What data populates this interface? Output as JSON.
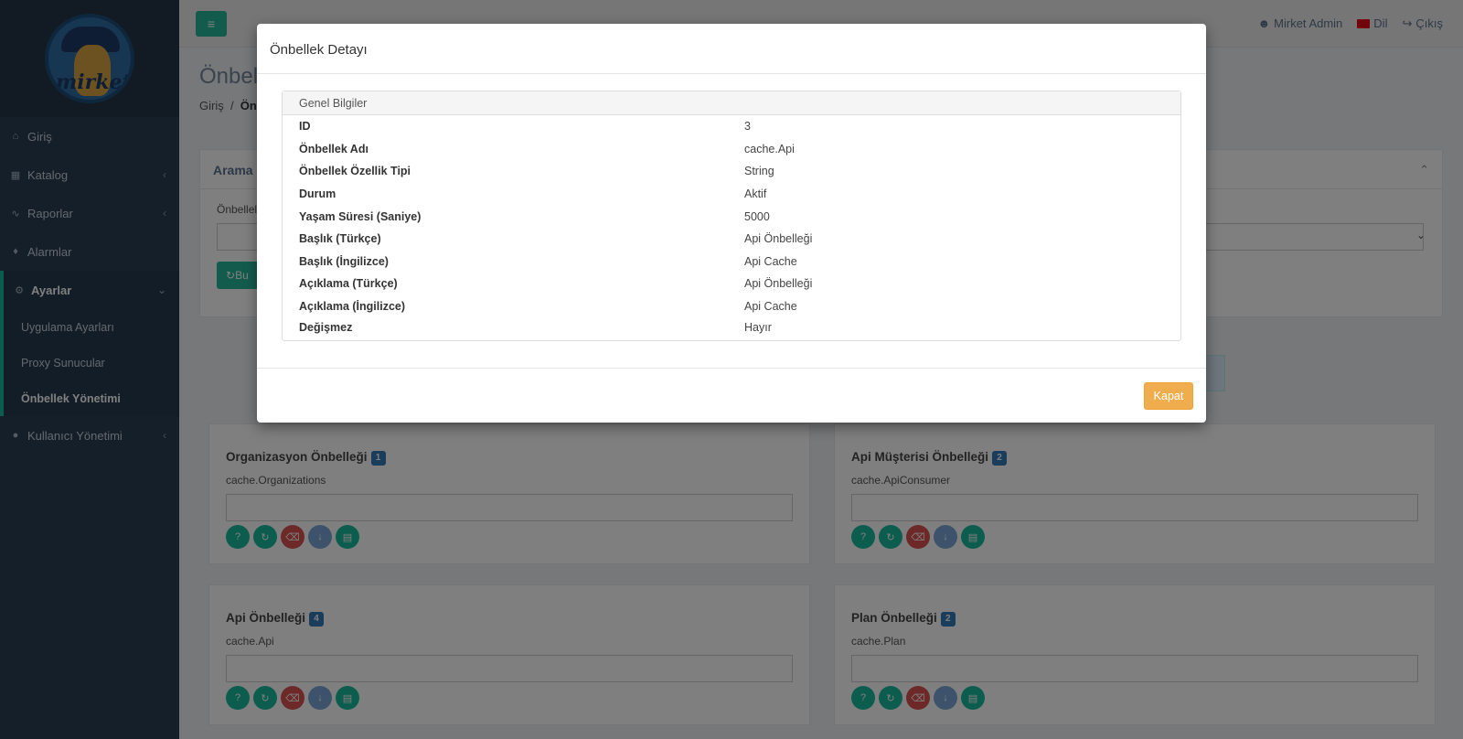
{
  "sidebar": {
    "logo_text": "mirket",
    "items": [
      {
        "label": "Giriş",
        "icon": "home-icon"
      },
      {
        "label": "Katalog",
        "icon": "sitemap-icon"
      },
      {
        "label": "Raporlar",
        "icon": "line-chart-icon"
      },
      {
        "label": "Alarmlar",
        "icon": "bell-icon"
      }
    ],
    "settings": {
      "label": "Ayarlar",
      "icon": "gears-icon",
      "sub_items": [
        {
          "label": "Uygulama Ayarları"
        },
        {
          "label": "Proxy Sunucular"
        },
        {
          "label": "Önbellek Yönetimi"
        }
      ]
    },
    "user_management": {
      "label": "Kullanıcı Yönetimi",
      "icon": "users-icon"
    }
  },
  "topbar": {
    "user": "Mirket Admin",
    "language": "Dil",
    "logout": "Çıkış"
  },
  "page": {
    "title": "Önbell",
    "breadcrumb_home": "Giriş",
    "breadcrumb_current": "Önl",
    "search_panel_title": "Arama K",
    "search_field_label": "Önbellel",
    "search_button": "Bu"
  },
  "cache_cards": [
    {
      "title": "Organizasyon Önbelleği",
      "count": "1",
      "key": "cache.Organizations"
    },
    {
      "title": "Api Müşterisi Önbelleği",
      "count": "2",
      "key": "cache.ApiConsumer"
    },
    {
      "title": "Api Önbelleği",
      "count": "4",
      "key": "cache.Api"
    },
    {
      "title": "Plan Önbelleği",
      "count": "2",
      "key": "cache.Plan"
    }
  ],
  "modal": {
    "title": "Önbellek Detayı",
    "section_title": "Genel Bilgiler",
    "rows": [
      {
        "key": "ID",
        "value": "3"
      },
      {
        "key": "Önbellek Adı",
        "value": "cache.Api"
      },
      {
        "key": "Önbellek Özellik Tipi",
        "value": "String"
      },
      {
        "key": "Durum",
        "value": "Aktif"
      },
      {
        "key": "Yaşam Süresi (Saniye)",
        "value": "5000"
      },
      {
        "key": "Başlık (Türkçe)",
        "value": "Api Önbelleği"
      },
      {
        "key": "Başlık (İngilizce)",
        "value": "Api Cache"
      },
      {
        "key": "Açıklama (Türkçe)",
        "value": "Api Önbelleği"
      },
      {
        "key": "Açıklama (İngilizce)",
        "value": "Api Cache"
      },
      {
        "key": "Değişmez",
        "value": "Hayır"
      }
    ],
    "close_label": "Kapat"
  },
  "colors": {
    "sidebar_bg": "#2a3f54",
    "accent_green": "#26b99a",
    "close_button": "#f0ad4e",
    "badge": "#337ab7"
  }
}
